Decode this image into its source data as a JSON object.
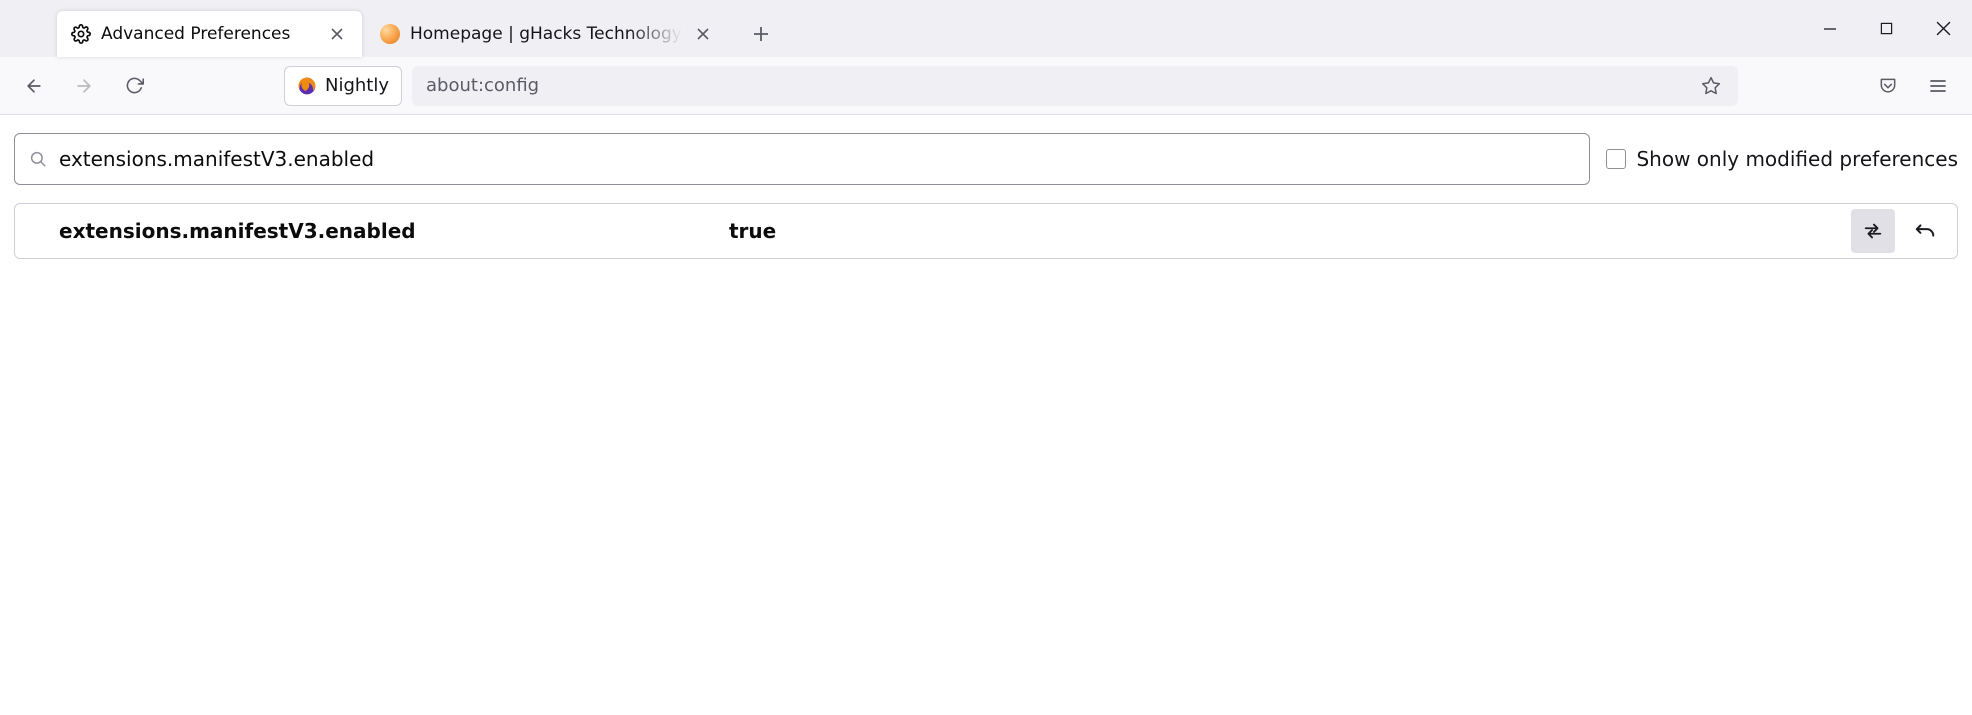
{
  "tabs": [
    {
      "title": "Advanced Preferences",
      "active": true
    },
    {
      "title": "Homepage | gHacks Technology",
      "active": false
    }
  ],
  "identity": {
    "label": "Nightly"
  },
  "urlbar": {
    "url": "about:config"
  },
  "search": {
    "value": "extensions.manifestV3.enabled",
    "checkbox_label": "Show only modified preferences"
  },
  "preference": {
    "name": "extensions.manifestV3.enabled",
    "value": "true"
  }
}
